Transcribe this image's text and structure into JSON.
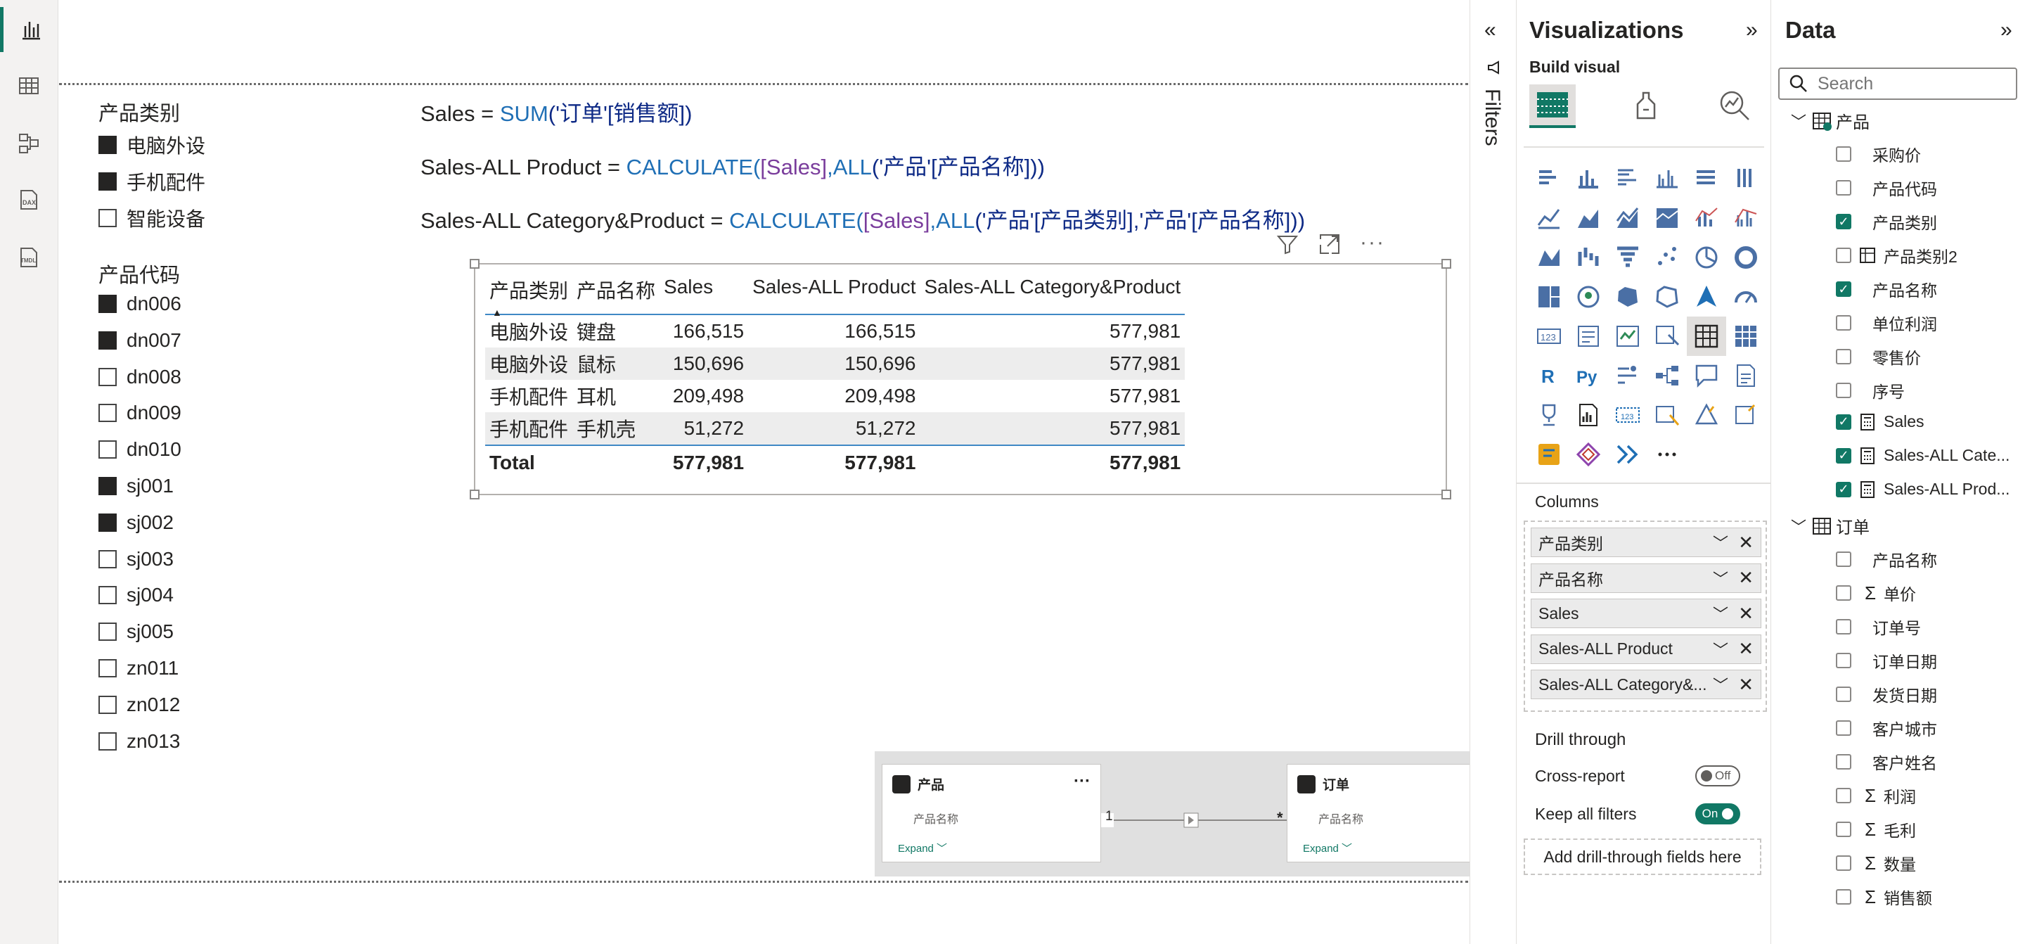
{
  "rail": {
    "items": [
      "report-view",
      "table-view",
      "model-view",
      "dax-query-view",
      "tmdl-view"
    ]
  },
  "slicers": {
    "category": {
      "title": "产品类别",
      "items": [
        {
          "label": "电脑外设",
          "checked": true
        },
        {
          "label": "手机配件",
          "checked": true
        },
        {
          "label": "智能设备",
          "checked": false
        }
      ]
    },
    "code": {
      "title": "产品代码",
      "items": [
        {
          "label": "dn006",
          "checked": true
        },
        {
          "label": "dn007",
          "checked": true
        },
        {
          "label": "dn008",
          "checked": false
        },
        {
          "label": "dn009",
          "checked": false
        },
        {
          "label": "dn010",
          "checked": false
        },
        {
          "label": "sj001",
          "checked": true
        },
        {
          "label": "sj002",
          "checked": true
        },
        {
          "label": "sj003",
          "checked": false
        },
        {
          "label": "sj004",
          "checked": false
        },
        {
          "label": "sj005",
          "checked": false
        },
        {
          "label": "zn011",
          "checked": false
        },
        {
          "label": "zn012",
          "checked": false
        },
        {
          "label": "zn013",
          "checked": false
        }
      ]
    }
  },
  "dax": {
    "line1": {
      "name": "Sales = ",
      "fn": "SUM",
      "args": "('订单'[销售额])"
    },
    "line2": {
      "name": "Sales-ALL Product = ",
      "fn": "CALCULATE",
      "open": "(",
      "measure": "[Sales]",
      "sep": ",",
      "fn2": "ALL",
      "args": "('产品'[产品名称]))"
    },
    "line3": {
      "name": "Sales-ALL Category&Product = ",
      "fn": "CALCULATE",
      "open": "(",
      "measure": "[Sales]",
      "sep": ",",
      "fn2": "ALL",
      "args": "('产品'[产品类别],'产品'[产品名称]))"
    }
  },
  "table": {
    "columns": [
      "产品类别",
      "产品名称",
      "Sales",
      "Sales-ALL Product",
      "Sales-ALL Category&Product"
    ],
    "rows": [
      [
        "电脑外设",
        "键盘",
        "166,515",
        "166,515",
        "577,981"
      ],
      [
        "电脑外设",
        "鼠标",
        "150,696",
        "150,696",
        "577,981"
      ],
      [
        "手机配件",
        "耳机",
        "209,498",
        "209,498",
        "577,981"
      ],
      [
        "手机配件",
        "手机壳",
        "51,272",
        "51,272",
        "577,981"
      ]
    ],
    "total": [
      "Total",
      "",
      "577,981",
      "577,981",
      "577,981"
    ]
  },
  "model": {
    "left": {
      "title": "产品",
      "field": "产品名称",
      "expand": "Expand"
    },
    "right": {
      "title": "订单",
      "field": "产品名称",
      "expand": "Expand"
    },
    "card_left": "1",
    "card_right": "*"
  },
  "filters": {
    "label": "Filters"
  },
  "viz": {
    "title": "Visualizations",
    "build_visual": "Build visual",
    "columns_label": "Columns",
    "wells": [
      "产品类别",
      "产品名称",
      "Sales",
      "Sales-ALL Product",
      "Sales-ALL Category&..."
    ],
    "drill_through": "Drill through",
    "cross_report": "Cross-report",
    "cross_report_state": "Off",
    "keep_filters": "Keep all filters",
    "keep_filters_state": "On",
    "add_drill": "Add drill-through fields here",
    "accent": "#117865"
  },
  "data": {
    "title": "Data",
    "search_placeholder": "Search",
    "tables": [
      {
        "name": "产品",
        "fields": [
          {
            "label": "采购价",
            "checked": false,
            "kind": "text"
          },
          {
            "label": "产品代码",
            "checked": false,
            "kind": "text"
          },
          {
            "label": "产品类别",
            "checked": true,
            "kind": "text"
          },
          {
            "label": "产品类别2",
            "checked": false,
            "kind": "calc-column"
          },
          {
            "label": "产品名称",
            "checked": true,
            "kind": "text"
          },
          {
            "label": "单位利润",
            "checked": false,
            "kind": "text"
          },
          {
            "label": "零售价",
            "checked": false,
            "kind": "text"
          },
          {
            "label": "序号",
            "checked": false,
            "kind": "text"
          },
          {
            "label": "Sales",
            "checked": true,
            "kind": "measure"
          },
          {
            "label": "Sales-ALL Cate...",
            "checked": true,
            "kind": "measure"
          },
          {
            "label": "Sales-ALL Prod...",
            "checked": true,
            "kind": "measure"
          }
        ]
      },
      {
        "name": "订单",
        "fields": [
          {
            "label": "产品名称",
            "checked": false,
            "kind": "text"
          },
          {
            "label": "单价",
            "checked": false,
            "kind": "sum"
          },
          {
            "label": "订单号",
            "checked": false,
            "kind": "text"
          },
          {
            "label": "订单日期",
            "checked": false,
            "kind": "text"
          },
          {
            "label": "发货日期",
            "checked": false,
            "kind": "text"
          },
          {
            "label": "客户城市",
            "checked": false,
            "kind": "text"
          },
          {
            "label": "客户姓名",
            "checked": false,
            "kind": "text"
          },
          {
            "label": "利润",
            "checked": false,
            "kind": "sum"
          },
          {
            "label": "毛利",
            "checked": false,
            "kind": "sum"
          },
          {
            "label": "数量",
            "checked": false,
            "kind": "sum"
          },
          {
            "label": "销售额",
            "checked": false,
            "kind": "sum"
          }
        ]
      }
    ]
  }
}
